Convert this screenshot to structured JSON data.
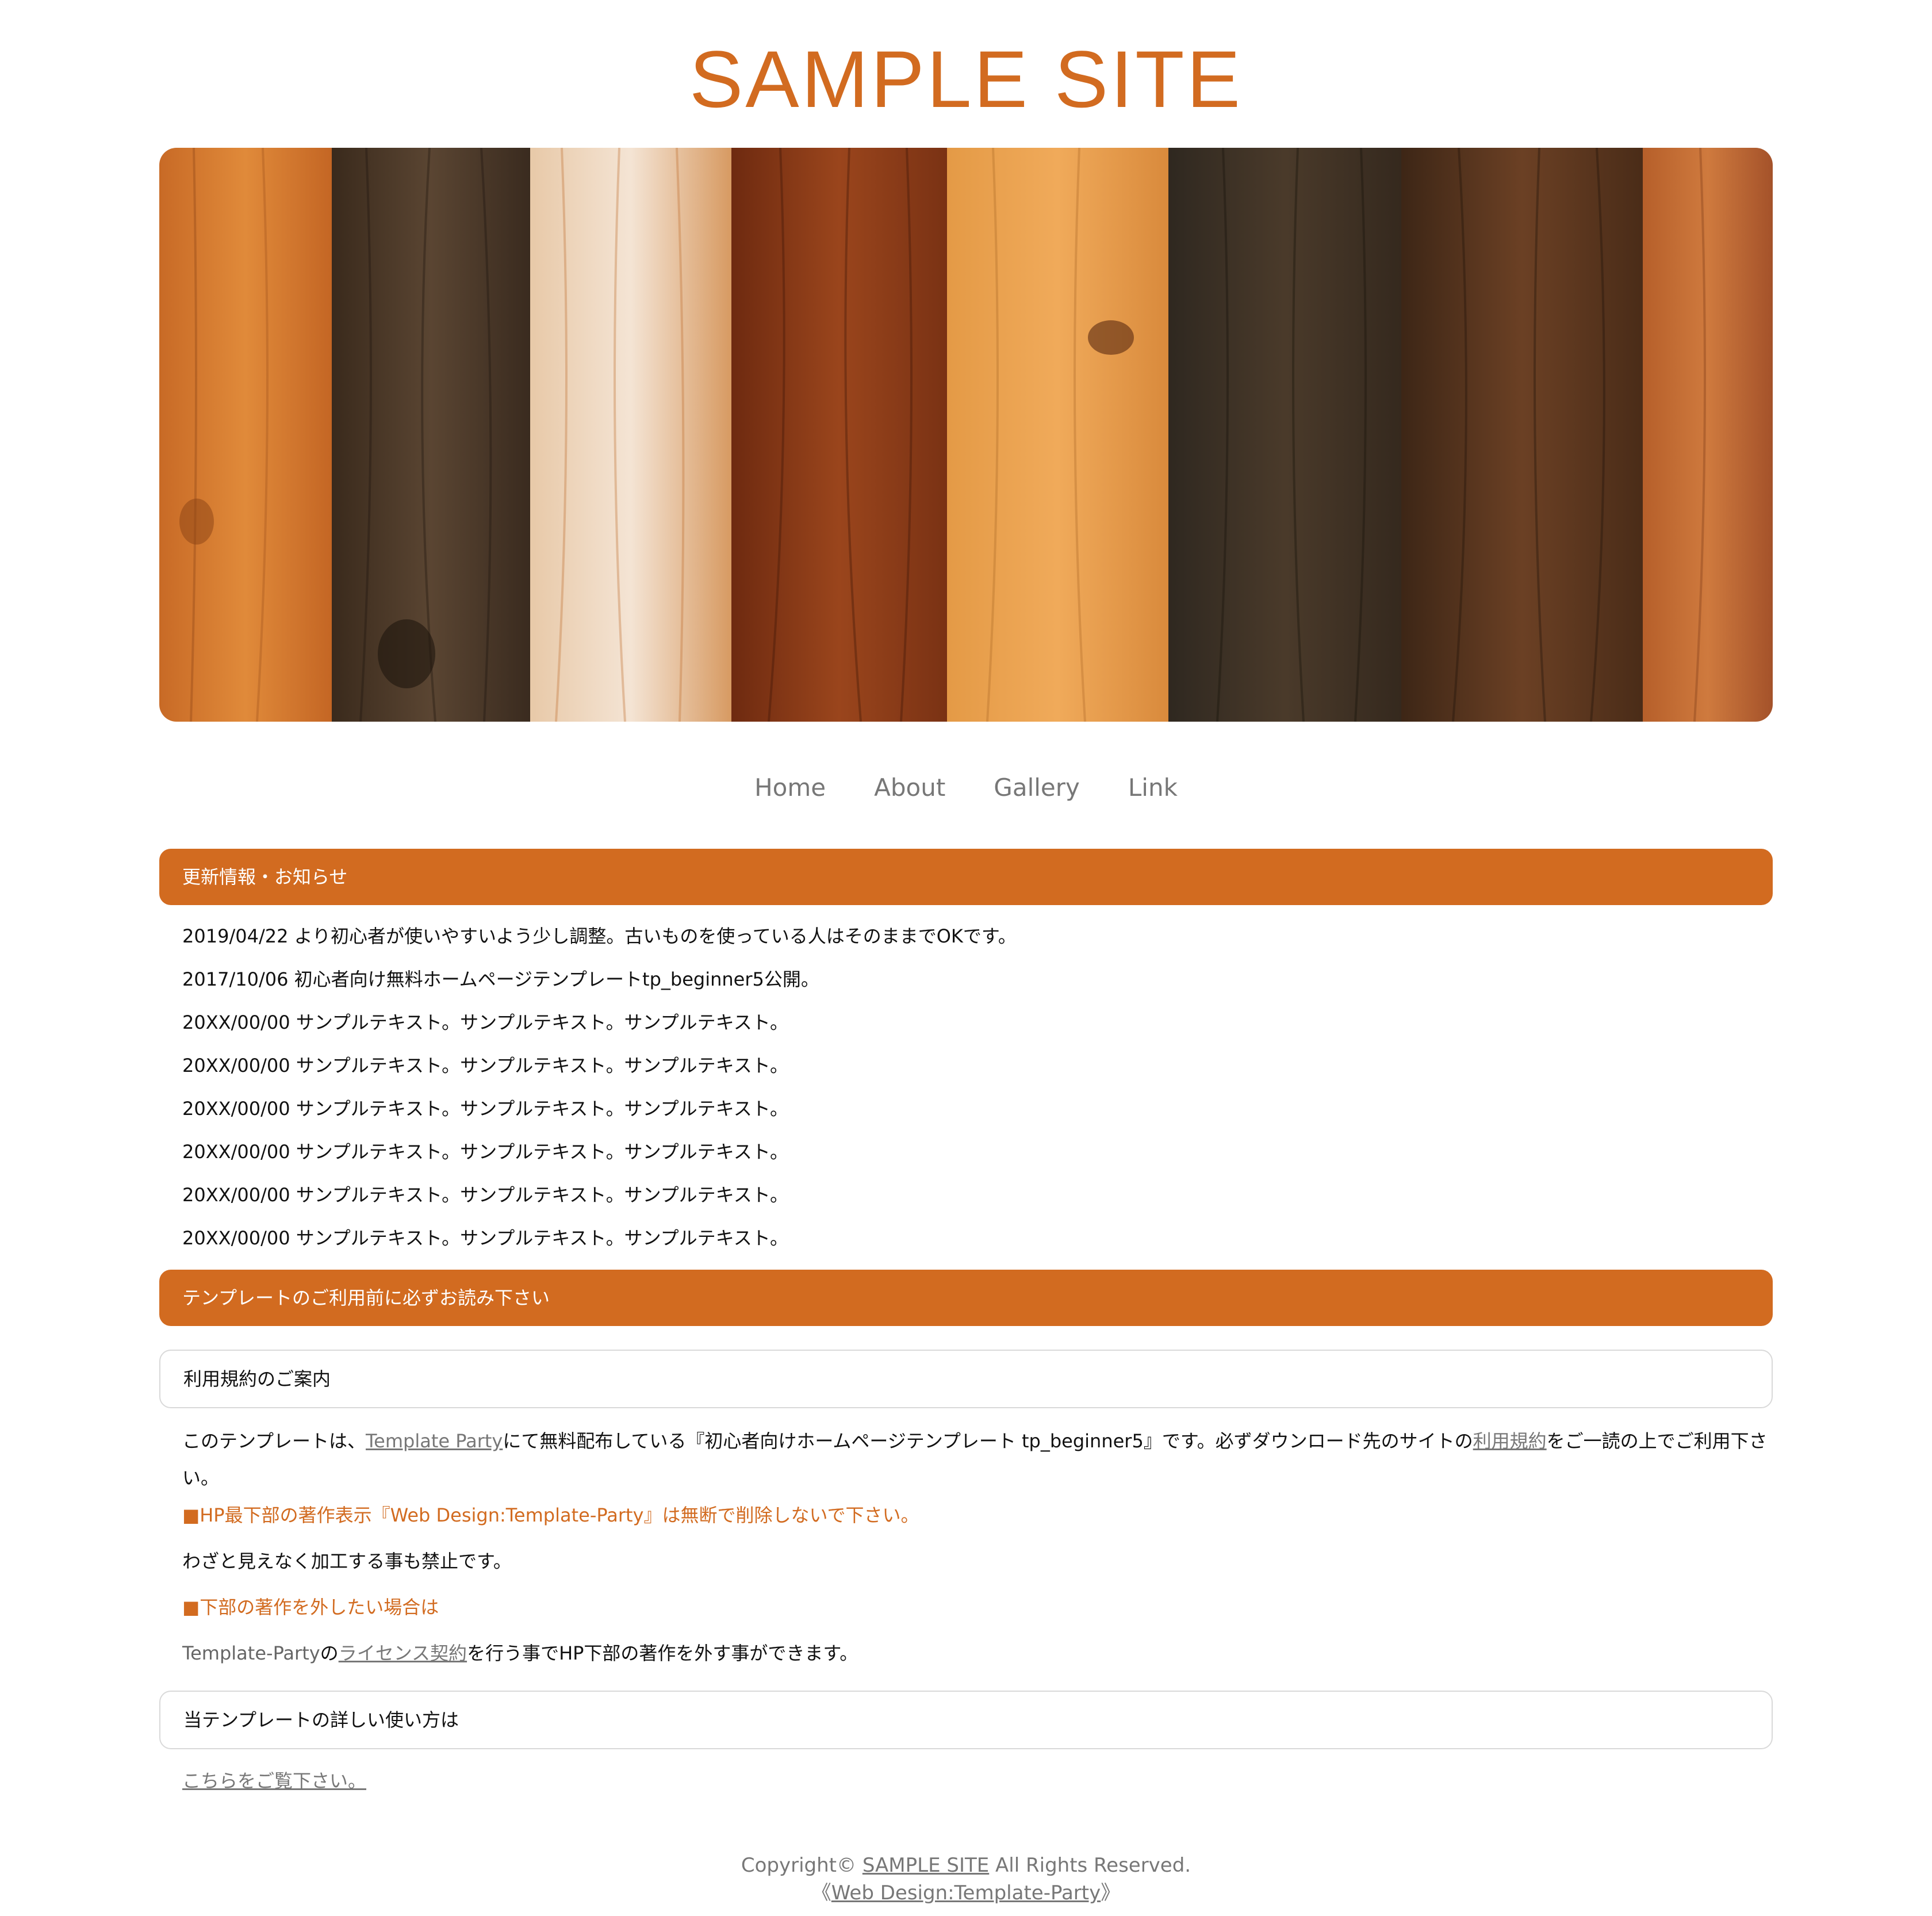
{
  "site": {
    "title": "SAMPLE SITE"
  },
  "colors": {
    "accent": "#d26b20",
    "link_grey": "#777777"
  },
  "nav": {
    "items": [
      {
        "label": "Home"
      },
      {
        "label": "About"
      },
      {
        "label": "Gallery"
      },
      {
        "label": "Link"
      }
    ]
  },
  "news": {
    "heading": "更新情報・お知らせ",
    "items": [
      "2019/04/22 より初心者が使いやすいよう少し調整。古いものを使っている人はそのままでOKです。",
      "2017/10/06 初心者向け無料ホームページテンプレートtp_beginner5公開。",
      "20XX/00/00 サンプルテキスト。サンプルテキスト。サンプルテキスト。",
      "20XX/00/00 サンプルテキスト。サンプルテキスト。サンプルテキスト。",
      "20XX/00/00 サンプルテキスト。サンプルテキスト。サンプルテキスト。",
      "20XX/00/00 サンプルテキスト。サンプルテキスト。サンプルテキスト。",
      "20XX/00/00 サンプルテキスト。サンプルテキスト。サンプルテキスト。",
      "20XX/00/00 サンプルテキスト。サンプルテキスト。サンプルテキスト。"
    ]
  },
  "notice": {
    "heading": "テンプレートのご利用前に必ずお読み下さい",
    "terms_box": "利用規約のご案内",
    "terms_para": {
      "pre": "このテンプレートは、",
      "link1": "Template Party",
      "mid": "にて無料配布している『初心者向けホームページテンプレート tp_beginner5』です。必ずダウンロード先のサイトの",
      "link2": "利用規約",
      "post": "をご一読の上でご利用下さい。"
    },
    "copyright_warning": "■HP最下部の著作表示『Web Design:Template-Party』は無断で削除しないで下さい。",
    "no_hiding": "わざと見えなく加工する事も禁止です。",
    "remove_heading": "■下部の著作を外したい場合は",
    "license_para": {
      "pre": "Template-Party",
      "mid": "の",
      "link": "ライセンス契約",
      "post": "を行う事でHP下部の著作を外す事ができます。"
    },
    "usage_box": "当テンプレートの詳しい使い方は",
    "usage_link": "こちらをご覧下さい。"
  },
  "footer": {
    "copyright_pre": "Copyright©",
    "site_link": "SAMPLE SITE",
    "copyright_post": "All Rights Reserved.",
    "credit_open": "《",
    "credit_link": "Web Design:Template-Party",
    "credit_close": "》"
  }
}
